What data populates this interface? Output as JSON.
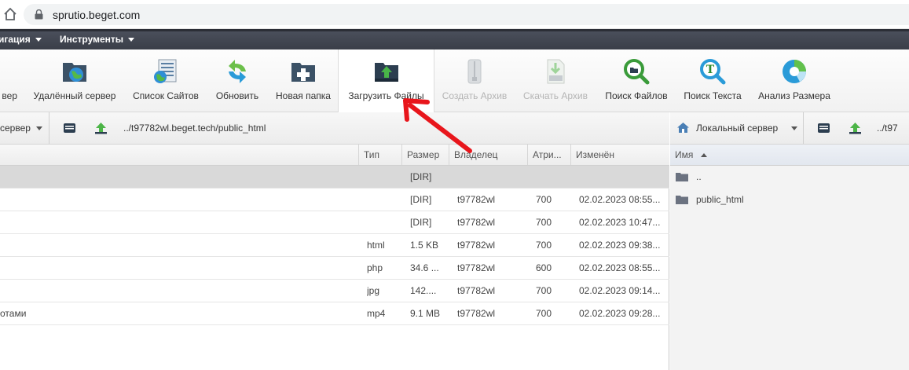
{
  "browser": {
    "url": "sprutio.beget.com",
    "home_icon": "home-icon",
    "lock_icon": "lock-icon"
  },
  "menu": {
    "items": [
      {
        "label": "игация"
      },
      {
        "label": "Инструменты"
      }
    ]
  },
  "toolbar": {
    "items": [
      {
        "label": "вер",
        "icon": "server-icon",
        "enabled": true
      },
      {
        "label": "Удалённый сервер",
        "icon": "remote-server-icon",
        "enabled": true
      },
      {
        "label": "Список Сайтов",
        "icon": "site-list-icon",
        "enabled": true
      },
      {
        "label": "Обновить",
        "icon": "refresh-icon",
        "enabled": true
      },
      {
        "label": "Новая папка",
        "icon": "new-folder-icon",
        "enabled": true
      },
      {
        "label": "Загрузить Файлы",
        "icon": "upload-icon",
        "enabled": true,
        "active": true
      },
      {
        "label": "Создать Архив",
        "icon": "archive-icon",
        "enabled": false
      },
      {
        "label": "Скачать Архив",
        "icon": "download-archive-icon",
        "enabled": false
      },
      {
        "label": "Поиск Файлов",
        "icon": "search-files-icon",
        "enabled": true
      },
      {
        "label": "Поиск Текста",
        "icon": "search-text-icon",
        "enabled": true
      },
      {
        "label": "Анализ Размера",
        "icon": "size-analysis-icon",
        "enabled": true
      }
    ]
  },
  "left_path": {
    "server_label": "сервер",
    "path": "../t97782wl.beget.tech/public_html"
  },
  "right_path": {
    "server_label": "Локальный сервер",
    "path": "../t97"
  },
  "left_table": {
    "columns": [
      "Тип",
      "Размер",
      "Владелец",
      "Атри...",
      "Изменён"
    ],
    "rows": [
      {
        "name": "",
        "type": "",
        "size": "[DIR]",
        "owner": "",
        "attr": "",
        "modified": "",
        "selected": true
      },
      {
        "name": "",
        "type": "",
        "size": "[DIR]",
        "owner": "t97782wl",
        "attr": "700",
        "modified": "02.02.2023 08:55..."
      },
      {
        "name": "",
        "type": "",
        "size": "[DIR]",
        "owner": "t97782wl",
        "attr": "700",
        "modified": "02.02.2023 10:47..."
      },
      {
        "name": "",
        "type": "html",
        "size": "1.5 KB",
        "owner": "t97782wl",
        "attr": "700",
        "modified": "02.02.2023 09:38..."
      },
      {
        "name": "",
        "type": "php",
        "size": "34.6 ...",
        "owner": "t97782wl",
        "attr": "600",
        "modified": "02.02.2023 08:55..."
      },
      {
        "name": "",
        "type": "jpg",
        "size": "142....",
        "owner": "t97782wl",
        "attr": "700",
        "modified": "02.02.2023 09:14..."
      },
      {
        "name": "отами",
        "type": "mp4",
        "size": "9.1 MB",
        "owner": "t97782wl",
        "attr": "700",
        "modified": "02.02.2023 09:28..."
      }
    ]
  },
  "right_table": {
    "column": "Имя",
    "rows": [
      {
        "name": ".."
      },
      {
        "name": "public_html"
      }
    ]
  },
  "colors": {
    "annotation_arrow": "#e8161c",
    "menu_bar": "#3f434d"
  }
}
